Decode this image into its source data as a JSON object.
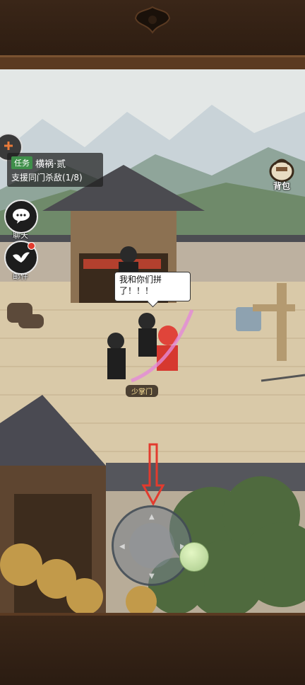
{
  "quest": {
    "tag": "任务",
    "title": "横祸·贰",
    "desc": "支援同门杀敌(1/8)"
  },
  "side_buttons": {
    "chat": "聊天",
    "mail": "邮件"
  },
  "bag": {
    "label": "背包"
  },
  "speech": {
    "text": "我和你们拼了！！！"
  },
  "player": {
    "name": "少掌门"
  },
  "colors": {
    "accent_red": "#e23b2e",
    "quest_tag": "#3f8f4a",
    "frame": "#3a2618"
  },
  "icons": [
    "settings-icon",
    "chat-bubble-icon",
    "mail-bird-icon",
    "bag-icon",
    "joystick-up-icon",
    "joystick-down-icon",
    "joystick-left-icon",
    "joystick-right-icon",
    "down-arrow-icon"
  ]
}
